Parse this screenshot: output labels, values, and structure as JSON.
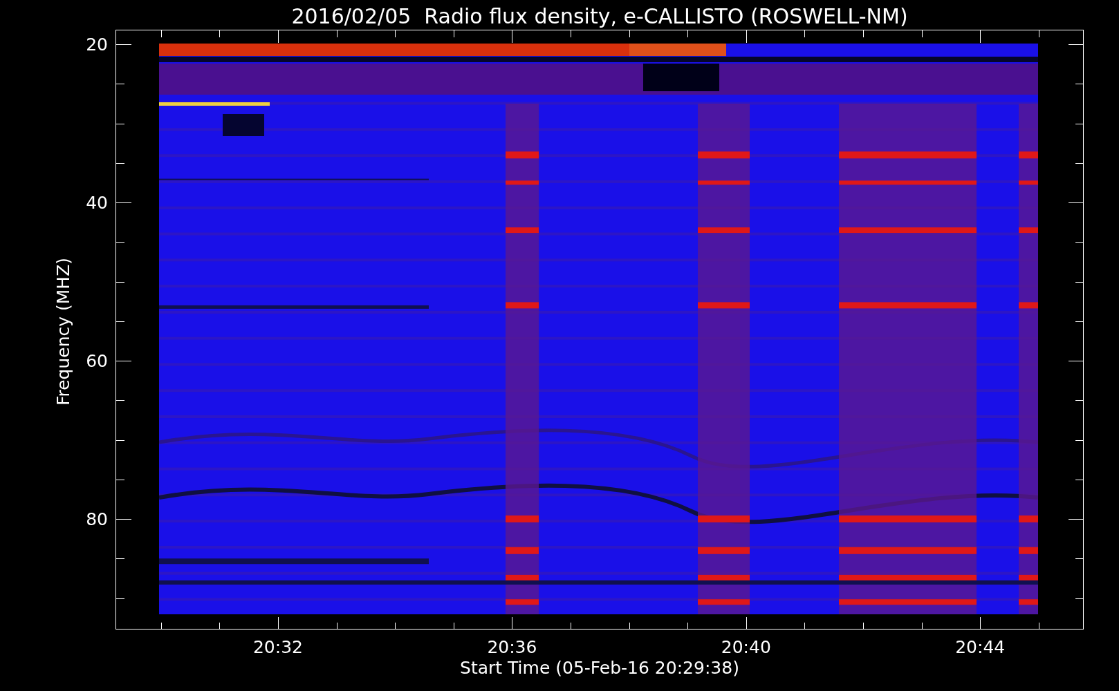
{
  "title": "2016/02/05  Radio flux density, e-CALLISTO (ROSWELL-NM)",
  "plot": {
    "ylabel": "Frequency (MHZ)",
    "xlabel": "Start Time (05-Feb-16 20:29:38)",
    "y_tick_labels": [
      "20",
      "40",
      "60",
      "80"
    ],
    "x_tick_labels": [
      "20:32",
      "20:36",
      "20:40",
      "20:44"
    ]
  }
}
